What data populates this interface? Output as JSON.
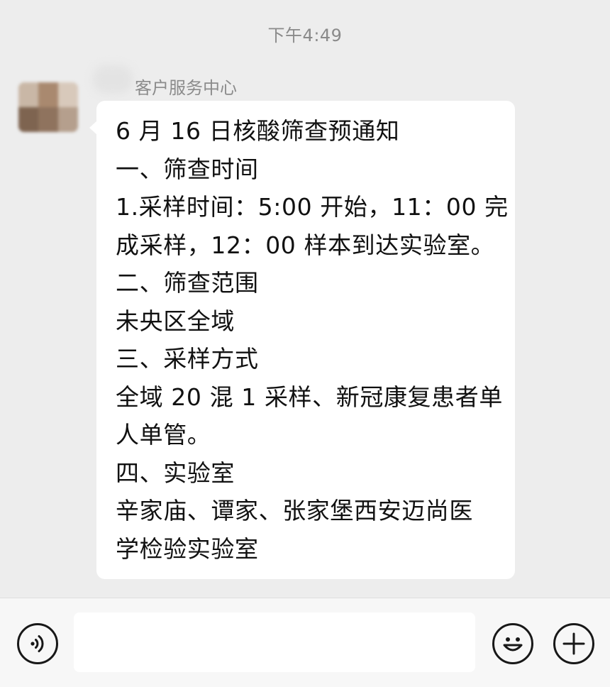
{
  "chat": {
    "timestamp": "下午4:49",
    "sender_name": "客户服务中心",
    "message_lines": [
      "6 月 16 日核酸筛查预通知",
      "一、筛查时间",
      "1.采样时间：5:00 开始，11：00 完",
      "成采样，12：00 样本到达实验室。",
      "二、筛查范围",
      "未央区全域",
      "三、采样方式",
      "全域 20 混 1 采样、新冠康复患者单",
      "人单管。",
      "四、实验室",
      "辛家庙、谭家、张家堡西安迈尚医",
      "学检验实验室"
    ]
  },
  "toolbar": {
    "voice_icon": "voice-icon",
    "emoji_icon": "emoji-icon",
    "plus_icon": "plus-icon",
    "input_value": ""
  },
  "colors": {
    "background": "#ededed",
    "bubble": "#ffffff",
    "toolbar": "#f7f7f7"
  }
}
